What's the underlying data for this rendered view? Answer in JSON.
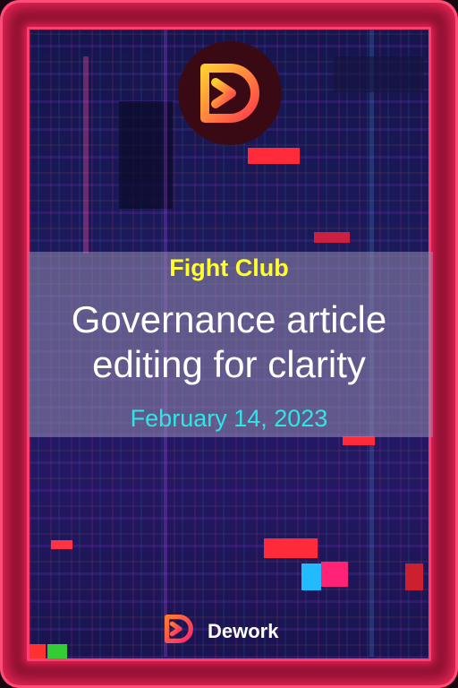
{
  "card": {
    "organization": "Fight Club",
    "title": "Governance article editing for clarity",
    "date": "February 14, 2023",
    "brand": "Dework"
  },
  "icons": {
    "top_logo": "dework-logo-icon",
    "footer_logo": "dework-logo-icon"
  },
  "colors": {
    "organization": "#ffff2e",
    "title": "#ffffff",
    "date": "#2ee6e6",
    "frame_glow": "#ff2a5c",
    "logo_gradient_start": "#ffcc33",
    "logo_gradient_end": "#ff3b4a"
  }
}
